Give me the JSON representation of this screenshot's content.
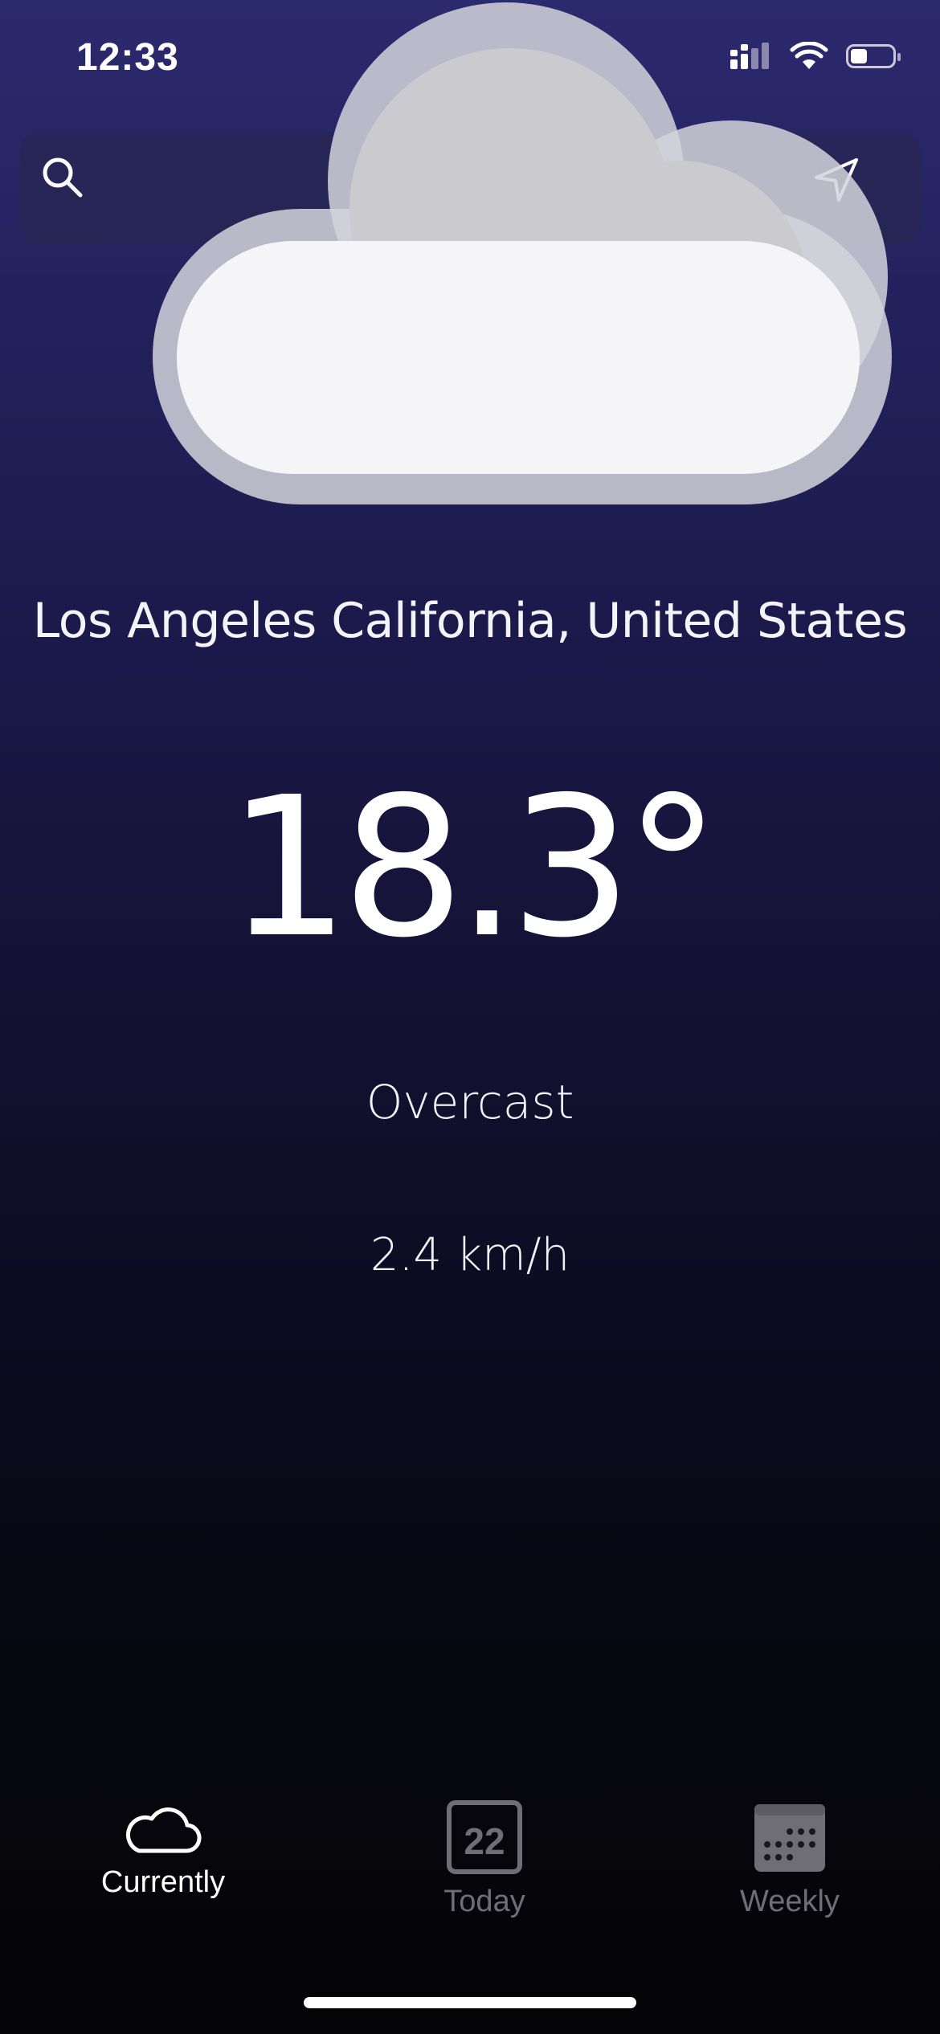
{
  "status_bar": {
    "time": "12:33",
    "battery_level": 0.4,
    "icons": [
      "cellular-signal-icon",
      "wifi-icon",
      "battery-icon"
    ]
  },
  "search": {
    "value": "",
    "placeholder": "",
    "icon": "search-icon",
    "location_icon": "location-arrow-icon"
  },
  "weather": {
    "icon": "cloud-icon",
    "location": "Los Angeles California, United States",
    "temperature": "18.3°",
    "condition": "Overcast",
    "wind_speed": "2.4 km/h"
  },
  "tabs": [
    {
      "label": "Currently",
      "icon": "cloud-outline-icon",
      "active": true
    },
    {
      "label": "Today",
      "icon": "calendar-day-icon",
      "icon_text": "22",
      "active": false
    },
    {
      "label": "Weekly",
      "icon": "calendar-week-icon",
      "active": false
    }
  ],
  "colors": {
    "background_top": "#2c2a6e",
    "background_bottom": "#040406",
    "active_tab": "#ffffff",
    "inactive_tab": "#6e6e74"
  }
}
